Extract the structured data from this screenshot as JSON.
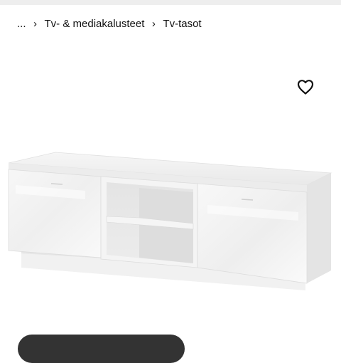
{
  "breadcrumb": {
    "items": [
      "...",
      "Tv- & mediakalusteet",
      "Tv-tasot"
    ],
    "separator": "›"
  },
  "product": {
    "image_icon": "tv-bench-white-high-gloss"
  },
  "favorite": {
    "icon": "heart-outline-icon"
  },
  "colors": {
    "topbar": "#eeeeee",
    "pill": "#333333",
    "text": "#111111"
  }
}
